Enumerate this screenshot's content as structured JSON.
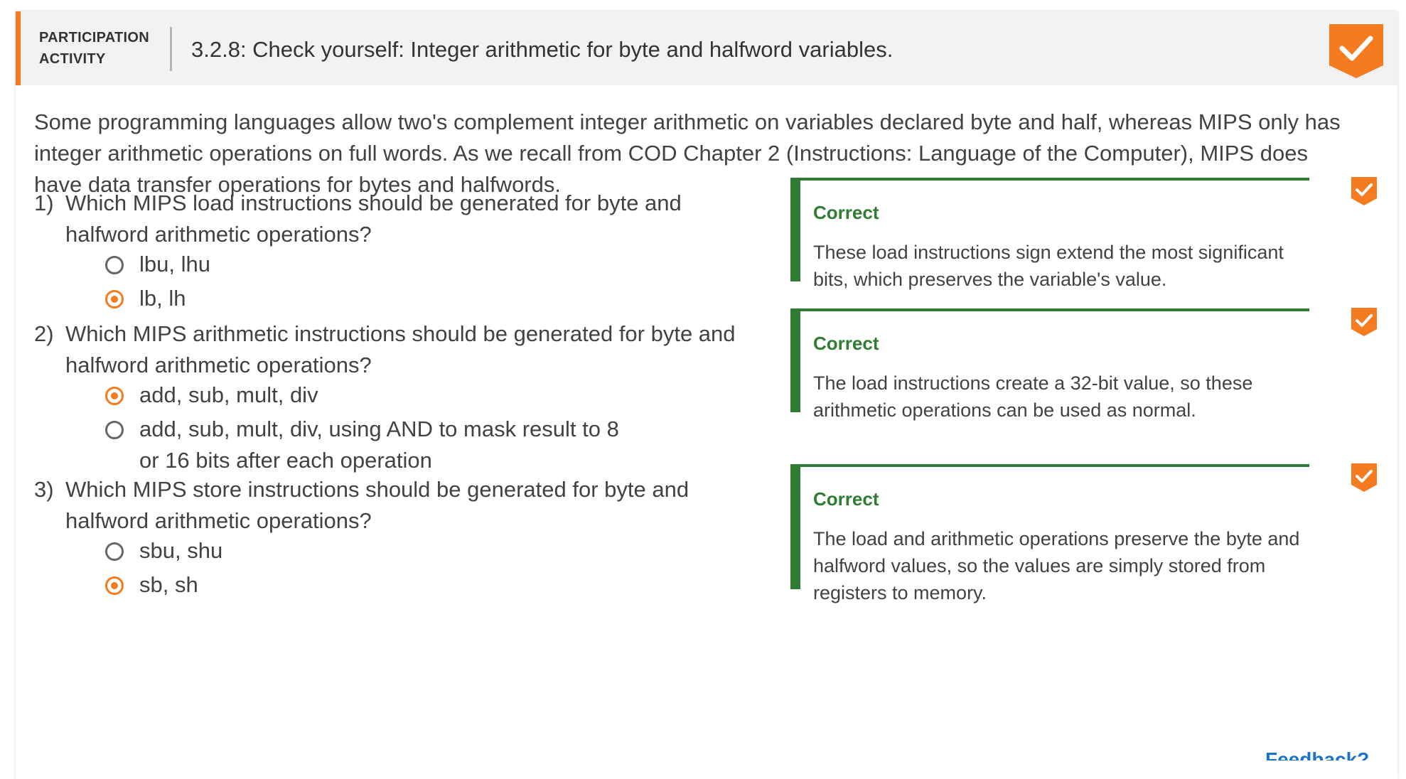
{
  "header": {
    "label_line1": "PARTICIPATION",
    "label_line2": "ACTIVITY",
    "title": "3.2.8: Check yourself: Integer arithmetic for byte and halfword variables.",
    "status_icon": "checkmark-badge-icon"
  },
  "intro": "Some programming languages allow two's complement integer arithmetic on variables declared byte and half, whereas MIPS only has integer arithmetic operations on full words. As we recall from COD Chapter 2 (Instructions: Language of the Computer), MIPS does have data transfer operations for bytes and halfwords.",
  "questions": [
    {
      "number": "1)",
      "text": "Which MIPS load instructions should be generated for byte and halfword arithmetic operations?",
      "options": [
        {
          "label": "lbu, lhu",
          "selected": false
        },
        {
          "label": "lb, lh",
          "selected": true
        }
      ],
      "feedback": {
        "title": "Correct",
        "text": "These load instructions sign extend the most significant bits, which preserves the variable's value."
      }
    },
    {
      "number": "2)",
      "text": "Which MIPS arithmetic instructions should be generated for byte and halfword arithmetic operations?",
      "options": [
        {
          "label": "add, sub, mult, div",
          "selected": true
        },
        {
          "label": "add, sub, mult, div, using AND to mask result to 8 or 16 bits after each operation",
          "selected": false
        }
      ],
      "feedback": {
        "title": "Correct",
        "text": "The load instructions create a 32-bit value, so these arithmetic operations can be used as normal."
      }
    },
    {
      "number": "3)",
      "text": "Which MIPS store instructions should be generated for byte and halfword arithmetic operations?",
      "options": [
        {
          "label": "sbu, shu",
          "selected": false
        },
        {
          "label": "sb, sh",
          "selected": true
        }
      ],
      "feedback": {
        "title": "Correct",
        "text": "The load and arithmetic operations preserve the byte and halfword values, so the values are simply stored from registers to memory."
      }
    }
  ],
  "footer": {
    "feedback_link": "Feedback?"
  },
  "colors": {
    "accent_orange": "#f47b20",
    "correct_green": "#2e7d32",
    "header_bg": "#f2f2f2"
  }
}
